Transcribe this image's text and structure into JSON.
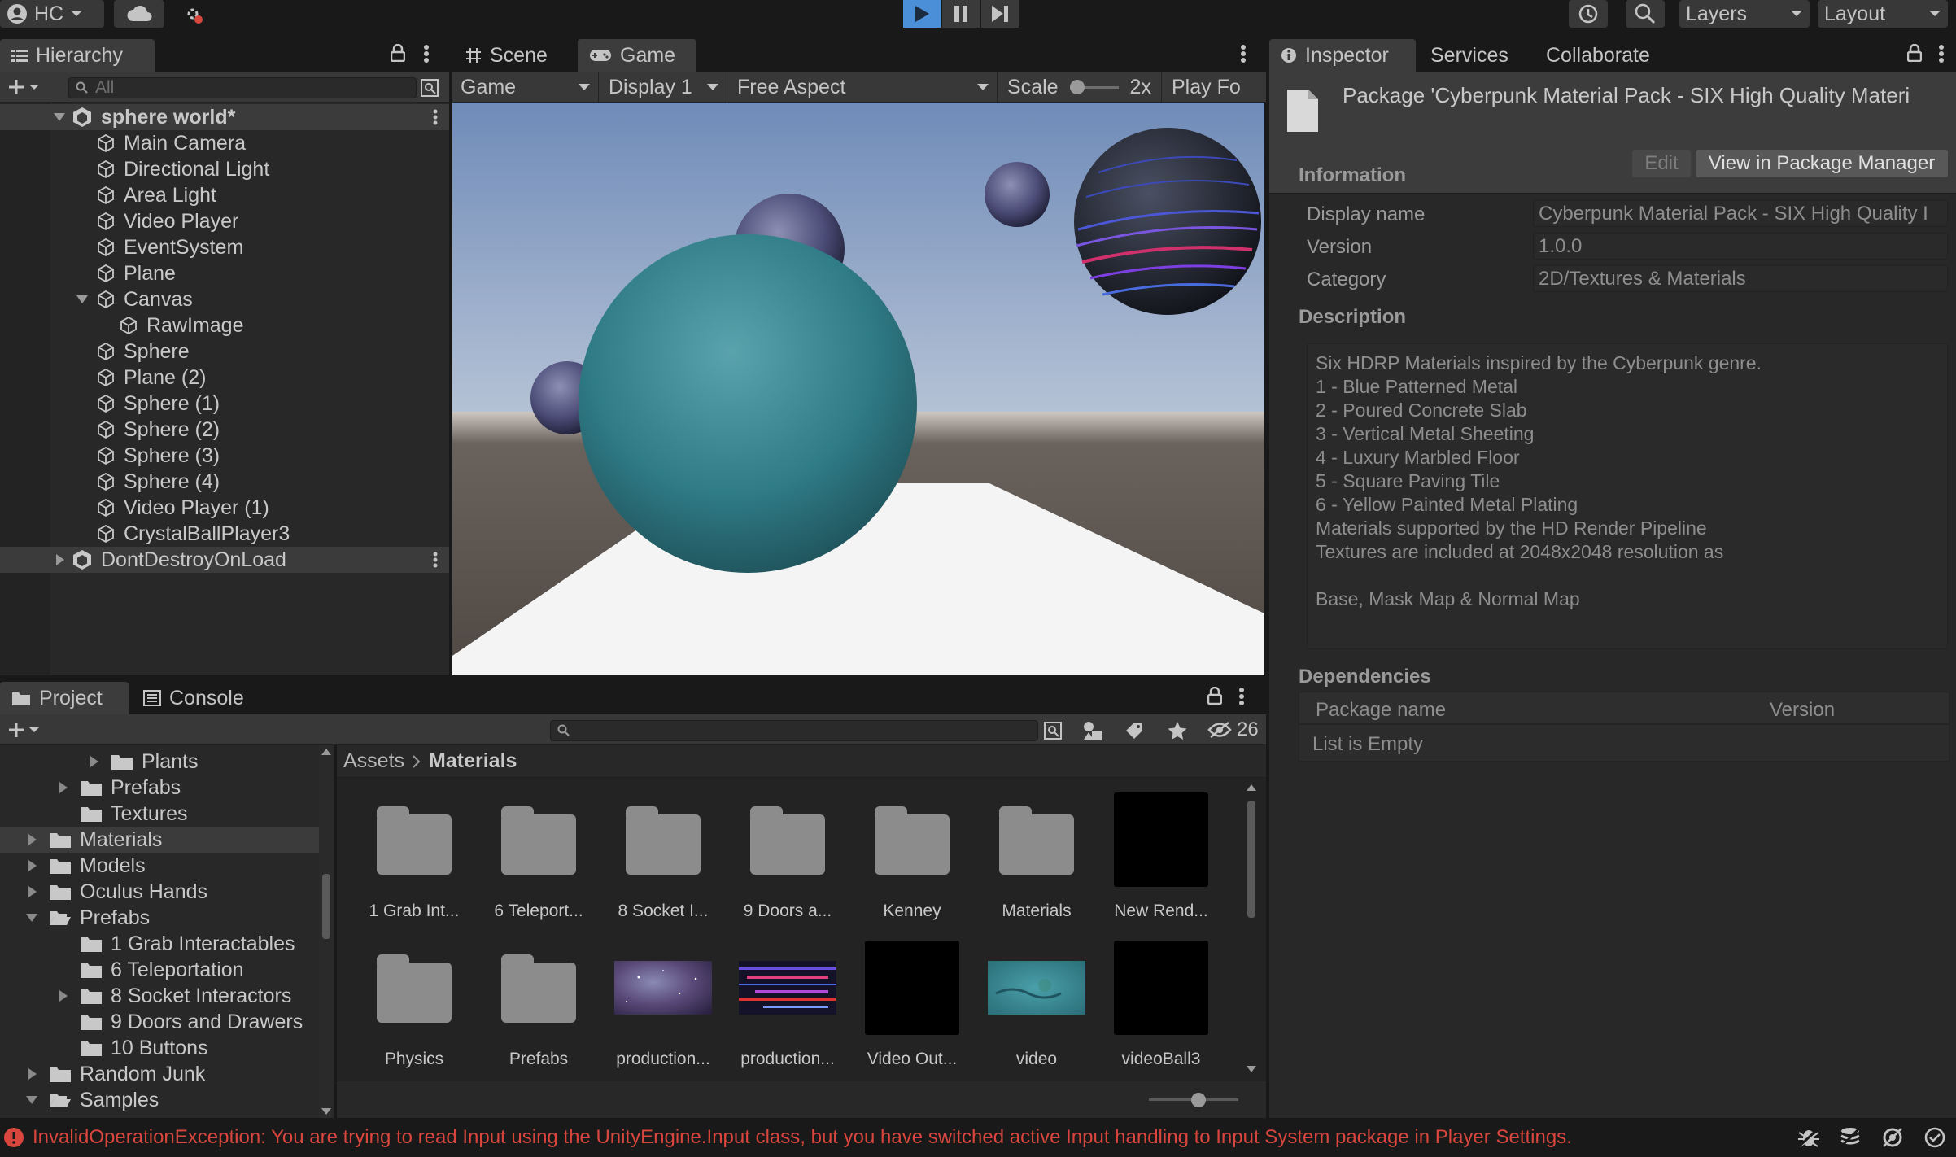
{
  "toolbar": {
    "account": "HC",
    "layers_label": "Layers",
    "layout_label": "Layout"
  },
  "hierarchy": {
    "tab": "Hierarchy",
    "search_placeholder": "All",
    "scene_name": "sphere world*",
    "items": [
      "Main Camera",
      "Directional Light",
      "Area Light",
      "Video Player",
      "EventSystem",
      "Plane",
      "Canvas",
      "RawImage",
      "Sphere",
      "Plane (2)",
      "Sphere (1)",
      "Sphere (2)",
      "Sphere (3)",
      "Sphere (4)",
      "Video Player (1)",
      "CrystalBallPlayer3"
    ],
    "dont_destroy": "DontDestroyOnLoad"
  },
  "game": {
    "tabs": [
      "Scene",
      "Game"
    ],
    "view_select": "Game",
    "display": "Display 1",
    "aspect": "Free Aspect",
    "scale_label": "Scale",
    "scale_value": "2x",
    "play_focused": "Play Fo"
  },
  "inspector": {
    "tabs": [
      "Inspector",
      "Services",
      "Collaborate"
    ],
    "package_title": "Package 'Cyberpunk Material Pack - SIX High Quality Materi",
    "edit_button": "Edit",
    "view_button": "View in Package Manager",
    "information_header": "Information",
    "fields": [
      {
        "label": "Display name",
        "value": "Cyberpunk Material Pack - SIX High Quality I"
      },
      {
        "label": "Version",
        "value": "1.0.0"
      },
      {
        "label": "Category",
        "value": "2D/Textures & Materials"
      }
    ],
    "description_header": "Description",
    "description_lines": [
      "Six HDRP Materials inspired by the Cyberpunk genre.",
      "1 - Blue Patterned Metal",
      "2 - Poured Concrete Slab",
      "3 - Vertical Metal Sheeting",
      "4 - Luxury Marbled Floor",
      "5 - Square Paving Tile",
      "6 - Yellow Painted Metal Plating",
      "Materials supported by the HD Render Pipeline",
      "Textures are included at 2048x2048 resolution as",
      "",
      "Base, Mask Map & Normal Map"
    ],
    "dependencies_header": "Dependencies",
    "dep_columns": [
      "Package name",
      "Version"
    ],
    "dep_empty": "List is Empty"
  },
  "project": {
    "tabs": [
      "Project",
      "Console"
    ],
    "hidden_count": "26",
    "tree": [
      {
        "label": "Plants",
        "indent": 2,
        "arrow": true
      },
      {
        "label": "Prefabs",
        "indent": 1,
        "arrow": true
      },
      {
        "label": "Textures",
        "indent": 1,
        "arrow": false
      },
      {
        "label": "Materials",
        "indent": 0,
        "arrow": true,
        "selected": true
      },
      {
        "label": "Models",
        "indent": 0,
        "arrow": true
      },
      {
        "label": "Oculus Hands",
        "indent": 0,
        "arrow": true
      },
      {
        "label": "Prefabs",
        "indent": 0,
        "arrow": "open"
      },
      {
        "label": "1 Grab Interactables",
        "indent": 1,
        "arrow": false
      },
      {
        "label": "6 Teleportation",
        "indent": 1,
        "arrow": false
      },
      {
        "label": "8 Socket Interactors",
        "indent": 1,
        "arrow": true
      },
      {
        "label": "9 Doors and Drawers",
        "indent": 1,
        "arrow": false
      },
      {
        "label": "10 Buttons",
        "indent": 1,
        "arrow": false
      },
      {
        "label": "Random Junk",
        "indent": 0,
        "arrow": true
      },
      {
        "label": "Samples",
        "indent": 0,
        "arrow": "open"
      }
    ],
    "breadcrumb": [
      "Assets",
      "Materials"
    ],
    "assets_row1": [
      {
        "label": "1 Grab Int...",
        "kind": "folder"
      },
      {
        "label": "6 Teleport...",
        "kind": "folder"
      },
      {
        "label": "8 Socket I...",
        "kind": "folder"
      },
      {
        "label": "9 Doors a...",
        "kind": "folder"
      },
      {
        "label": "Kenney",
        "kind": "folder"
      },
      {
        "label": "Materials",
        "kind": "folder"
      },
      {
        "label": "New Rend...",
        "kind": "black"
      }
    ],
    "assets_row2": [
      {
        "label": "Physics",
        "kind": "folder"
      },
      {
        "label": "Prefabs",
        "kind": "folder"
      },
      {
        "label": "production...",
        "kind": "galaxy"
      },
      {
        "label": "production...",
        "kind": "stripes"
      },
      {
        "label": "Video Out...",
        "kind": "black"
      },
      {
        "label": "video",
        "kind": "water"
      },
      {
        "label": "videoBall3",
        "kind": "black"
      }
    ]
  },
  "status": {
    "message": "InvalidOperationException: You are trying to read Input using the UnityEngine.Input class, but you have switched active Input handling to Input System package in Player Settings."
  },
  "colors": {
    "error": "#d9463d",
    "play_accent": "#4a8fd8",
    "sky_top": "#6f8bb8",
    "ground": "#57504a"
  }
}
